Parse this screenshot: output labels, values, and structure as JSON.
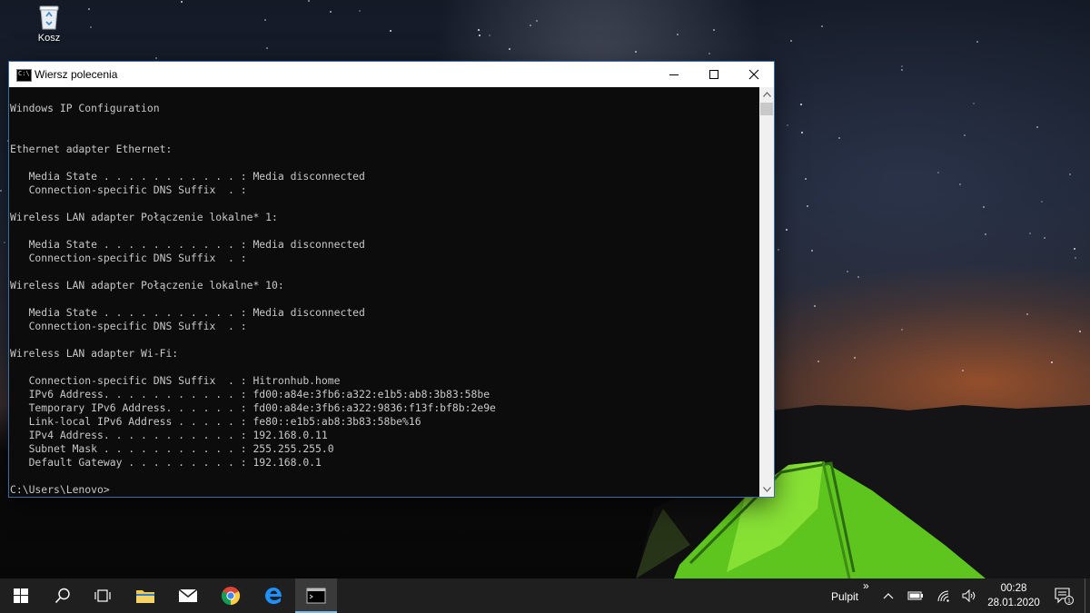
{
  "desktop": {
    "icons": [
      {
        "label": "Kosz",
        "icon": "recycle-bin-icon"
      }
    ]
  },
  "window": {
    "title": "Wiersz polecenia",
    "icon": "command-prompt-icon",
    "controls": {
      "minimize": "minimize-icon",
      "maximize": "maximize-icon",
      "close": "close-icon"
    }
  },
  "console": {
    "lines": [
      "Windows IP Configuration",
      "",
      "",
      "Ethernet adapter Ethernet:",
      "",
      "   Media State . . . . . . . . . . . : Media disconnected",
      "   Connection-specific DNS Suffix  . :",
      "",
      "Wireless LAN adapter Połączenie lokalne* 1:",
      "",
      "   Media State . . . . . . . . . . . : Media disconnected",
      "   Connection-specific DNS Suffix  . :",
      "",
      "Wireless LAN adapter Połączenie lokalne* 10:",
      "",
      "   Media State . . . . . . . . . . . : Media disconnected",
      "   Connection-specific DNS Suffix  . :",
      "",
      "Wireless LAN adapter Wi-Fi:",
      "",
      "   Connection-specific DNS Suffix  . : Hitronhub.home",
      "   IPv6 Address. . . . . . . . . . . : fd00:a84e:3fb6:a322:e1b5:ab8:3b83:58be",
      "   Temporary IPv6 Address. . . . . . : fd00:a84e:3fb6:a322:9836:f13f:bf8b:2e9e",
      "   Link-local IPv6 Address . . . . . : fe80::e1b5:ab8:3b83:58be%16",
      "   IPv4 Address. . . . . . . . . . . : 192.168.0.11",
      "   Subnet Mask . . . . . . . . . . . : 255.255.255.0",
      "   Default Gateway . . . . . . . . . : 192.168.0.1",
      "",
      "C:\\Users\\Lenovo>"
    ]
  },
  "taskbar": {
    "pinned": [
      {
        "name": "start-button",
        "icon": "windows-logo-icon"
      },
      {
        "name": "search-button",
        "icon": "search-icon"
      },
      {
        "name": "task-view-button",
        "icon": "task-view-icon"
      },
      {
        "name": "file-explorer-button",
        "icon": "folder-icon"
      },
      {
        "name": "mail-button",
        "icon": "mail-icon"
      },
      {
        "name": "chrome-button",
        "icon": "chrome-icon"
      },
      {
        "name": "edge-button",
        "icon": "edge-icon"
      },
      {
        "name": "cmd-taskbar-button",
        "icon": "command-prompt-icon",
        "active": true
      }
    ],
    "desktop_toolbar_label": "Pulpit",
    "toolbar_chevron": "»",
    "tray_icons": [
      "chevron-up-icon",
      "battery-icon",
      "wifi-icon",
      "volume-icon"
    ],
    "clock": {
      "time": "00:28",
      "date": "28.01.2020"
    },
    "notifications": {
      "icon": "action-center-icon",
      "count": "1"
    }
  }
}
